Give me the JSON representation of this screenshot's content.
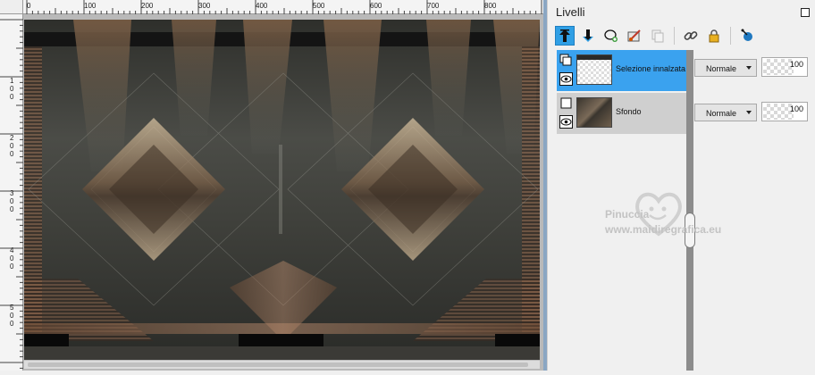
{
  "rulers": {
    "horizontal_labels": [
      "0",
      "100",
      "200",
      "300",
      "400",
      "500",
      "600",
      "700",
      "800"
    ],
    "vertical_labels": [
      "1 0 0",
      "2 0 0",
      "3 0 0",
      "4 0 0",
      "5 0 0"
    ]
  },
  "panel": {
    "title": "Livelli"
  },
  "toolbar": {
    "icons": [
      "move-layer-up-icon",
      "move-layer-down-icon",
      "new-layer-icon",
      "brush-layer-icon",
      "duplicate-layer-icon",
      "link-layers-icon",
      "lock-layer-icon",
      "layer-properties-icon"
    ]
  },
  "layers": [
    {
      "name": "Selezione innalzata",
      "blend": "Normale",
      "opacity": "100",
      "selected": true
    },
    {
      "name": "Sfondo",
      "blend": "Normale",
      "opacity": "100",
      "selected": false
    }
  ],
  "watermark": {
    "name": "Pinuccia",
    "url": "www.maidiregrafica.eu"
  },
  "colors": {
    "selected_layer": "#3aa2ef",
    "accent": "#2f9fe5"
  }
}
